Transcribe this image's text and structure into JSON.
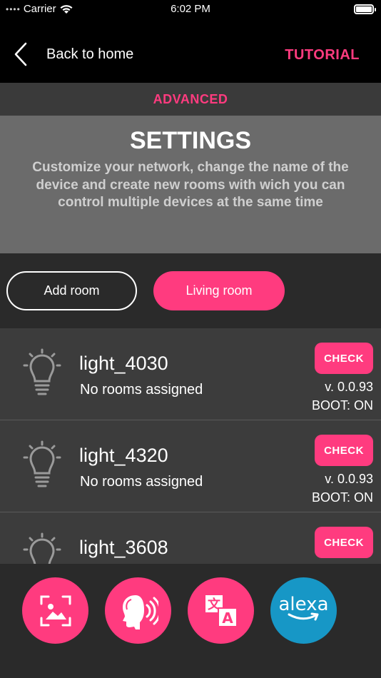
{
  "status_bar": {
    "carrier": "Carrier",
    "time": "6:02 PM"
  },
  "nav": {
    "back_label": "Back to home",
    "tutorial_label": "TUTORIAL"
  },
  "advanced": {
    "label": "ADVANCED"
  },
  "settings": {
    "title": "SETTINGS",
    "description": "Customize your network, change the name of the device and create new rooms with wich you can control multiple devices at the same time"
  },
  "rooms": {
    "add_label": "Add room",
    "living_label": "Living room"
  },
  "devices": [
    {
      "name": "light_4030",
      "rooms": "No rooms assigned",
      "check_label": "CHECK",
      "version": "v. 0.0.93",
      "boot": "BOOT: ON"
    },
    {
      "name": "light_4320",
      "rooms": "No rooms assigned",
      "check_label": "CHECK",
      "version": "v. 0.0.93",
      "boot": "BOOT: ON"
    },
    {
      "name": "light_3608",
      "rooms": "",
      "check_label": "CHECK",
      "version": "",
      "boot": ""
    }
  ],
  "toolbar": {
    "alexa_label": "alexa"
  },
  "colors": {
    "accent": "#ff3b7f",
    "alexa_blue": "#1797c6",
    "panel": "#3c3c3c"
  }
}
